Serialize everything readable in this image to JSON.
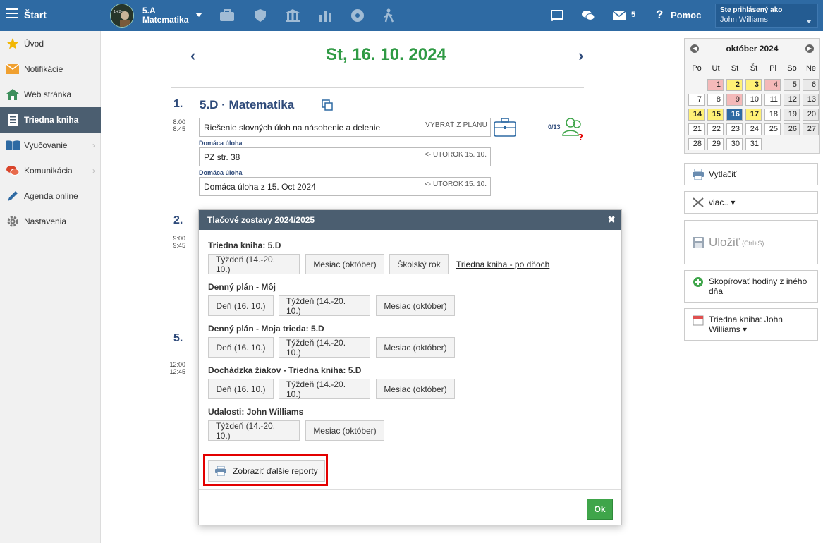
{
  "topbar": {
    "start_label": "Štart",
    "class_name": "5.A",
    "subject": "Matematika",
    "message_count": "5",
    "help_label": "Pomoc",
    "logged_as": "Ste prihlásený ako",
    "user_name": "John Williams",
    "color": "#2e6aa3"
  },
  "sidebar": {
    "items": [
      {
        "label": "Úvod",
        "icon": "star-icon"
      },
      {
        "label": "Notifikácie",
        "icon": "envelope-icon"
      },
      {
        "label": "Web stránka",
        "icon": "home-icon"
      },
      {
        "label": "Triedna kniha",
        "icon": "book-icon",
        "active": true
      },
      {
        "label": "Vyučovanie",
        "icon": "open-book-icon"
      },
      {
        "label": "Komunikácia",
        "icon": "chat-icon"
      },
      {
        "label": "Agenda online",
        "icon": "pen-icon"
      },
      {
        "label": "Nastavenia",
        "icon": "gear-icon"
      }
    ]
  },
  "main": {
    "date_title": "St, 16. 10. 2024",
    "prev": "‹",
    "next": "›",
    "lesson1": {
      "number": "1.",
      "time_start": "8:00",
      "time_end": "8:45",
      "title": "5.D · Matematika",
      "topic": "Riešenie slovných úloh na násobenie a delenie",
      "plan_label": "VYBRAŤ Z PLÁNU",
      "attendance": "0/13",
      "homework": [
        {
          "label": "Domáca úloha",
          "text": "PZ str. 38",
          "date": "<- UTOROK 15. 10."
        },
        {
          "label": "Domáca úloha",
          "text": "Domáca úloha z 15. Oct 2024",
          "date": "<- UTOROK 15. 10."
        }
      ]
    },
    "lesson2": {
      "number": "2.",
      "time_start": "9:00",
      "time_end": "9:45"
    },
    "lesson5": {
      "number": "5.",
      "time_start": "12:00",
      "time_end": "12:45"
    }
  },
  "calendar": {
    "title": "október 2024",
    "days_of_week": [
      "Po",
      "Ut",
      "St",
      "Št",
      "Pi",
      "So",
      "Ne"
    ],
    "weeks": [
      [
        null,
        {
          "d": "1",
          "s": "red"
        },
        {
          "d": "2",
          "s": "yellow"
        },
        {
          "d": "3",
          "s": "yellow"
        },
        {
          "d": "4",
          "s": "red"
        },
        {
          "d": "5",
          "s": "weekend"
        },
        {
          "d": "6",
          "s": "weekend"
        }
      ],
      [
        {
          "d": "7",
          "s": ""
        },
        {
          "d": "8",
          "s": ""
        },
        {
          "d": "9",
          "s": "red"
        },
        {
          "d": "10",
          "s": ""
        },
        {
          "d": "11",
          "s": ""
        },
        {
          "d": "12",
          "s": "weekend"
        },
        {
          "d": "13",
          "s": "weekend"
        }
      ],
      [
        {
          "d": "14",
          "s": "yellow"
        },
        {
          "d": "15",
          "s": "yellow"
        },
        {
          "d": "16",
          "s": "today"
        },
        {
          "d": "17",
          "s": "yellow"
        },
        {
          "d": "18",
          "s": ""
        },
        {
          "d": "19",
          "s": "weekend"
        },
        {
          "d": "20",
          "s": "weekend"
        }
      ],
      [
        {
          "d": "21",
          "s": ""
        },
        {
          "d": "22",
          "s": ""
        },
        {
          "d": "23",
          "s": ""
        },
        {
          "d": "24",
          "s": ""
        },
        {
          "d": "25",
          "s": ""
        },
        {
          "d": "26",
          "s": "weekend"
        },
        {
          "d": "27",
          "s": "weekend"
        }
      ],
      [
        {
          "d": "28",
          "s": ""
        },
        {
          "d": "29",
          "s": ""
        },
        {
          "d": "30",
          "s": ""
        },
        {
          "d": "31",
          "s": ""
        },
        null,
        null,
        null
      ]
    ]
  },
  "right_panel": {
    "print": "Vytlačiť",
    "more": "viac.. ▾",
    "save": "Uložiť",
    "save_shortcut": "(Ctrl+S)",
    "copy_lessons": "Skopírovať hodiny z iného dňa",
    "class_book": "Triedna kniha: John Williams ▾"
  },
  "modal": {
    "title": "Tlačové zostavy 2024/2025",
    "close": "✖",
    "sections": [
      {
        "title": "Triedna kniha: 5.D",
        "buttons": [
          "Týždeň (14.-20. 10.)",
          "Mesiac (október)",
          "Školský rok"
        ],
        "link": "Triedna kniha - po dňoch"
      },
      {
        "title": "Denný plán - Môj",
        "buttons": [
          "Deň (16. 10.)",
          "Týždeň (14.-20. 10.)",
          "Mesiac (október)"
        ]
      },
      {
        "title": "Denný plán - Moja trieda: 5.D",
        "buttons": [
          "Deň (16. 10.)",
          "Týždeň (14.-20. 10.)",
          "Mesiac (október)"
        ]
      },
      {
        "title": "Dochádzka žiakov - Triedna kniha: 5.D",
        "buttons": [
          "Deň (16. 10.)",
          "Týždeň (14.-20. 10.)",
          "Mesiac (október)"
        ]
      },
      {
        "title": "Udalosti: John Williams",
        "buttons": [
          "Týždeň (14.-20. 10.)",
          "Mesiac (október)"
        ]
      }
    ],
    "more_reports": "Zobraziť ďalšie reporty",
    "ok": "Ok"
  }
}
